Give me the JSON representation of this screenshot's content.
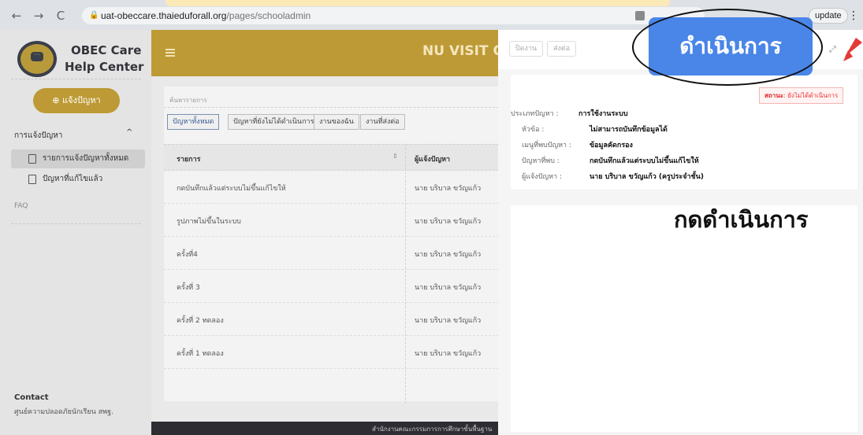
{
  "browser": {
    "url_host": "uat-obeccare.thaieduforall.org",
    "url_path": "/pages/schooladmin",
    "update_label": "update"
  },
  "sidebar": {
    "brand_line1": "OBEC Care",
    "brand_line2": "Help Center",
    "report_button": "แจ้งปัญหา",
    "section_title": "การแจ้งปัญหา",
    "items": [
      {
        "label": "รายการแจ้งปัญหาทั้งหมด",
        "active": true
      },
      {
        "label": "ปัญหาที่แก้ไขแล้ว",
        "active": false
      }
    ],
    "faq": "FAQ",
    "contact_title": "Contact",
    "contact_sub": "ศูนย์ความปลอดภัยนักเรียน สพฐ."
  },
  "header": {
    "title": "NU VISIT OT"
  },
  "list": {
    "search_placeholder": "ค้นหารายการ",
    "tabs": [
      "ปัญหาทั้งหมด",
      "ปัญหาที่ยังไม่ได้ดำเนินการ",
      "งานของฉัน",
      "งานที่ส่งต่อ"
    ],
    "columns": [
      "รายการ",
      "ผู้แจ้งปัญหา"
    ],
    "rows": [
      {
        "item": "กดบันทึกแล้วแต่ระบบไม่ขึ้นแก้ไขให้",
        "reporter": "นาย บริบาล ขวัญแก้ว"
      },
      {
        "item": "รูปภาพไม่ขึ้นในระบบ",
        "reporter": "นาย บริบาล ขวัญแก้ว"
      },
      {
        "item": "ครั้งที่4",
        "reporter": "นาย บริบาล ขวัญแก้ว"
      },
      {
        "item": "ครั้งที่ 3",
        "reporter": "นาย บริบาล ขวัญแก้ว"
      },
      {
        "item": "ครั้งที่ 2 ทดลอง",
        "reporter": "นาย บริบาล ขวัญแก้ว"
      },
      {
        "item": "ครั้งที่ 1 ทดลอง",
        "reporter": "นาย บริบาล ขวัญแก้ว"
      }
    ]
  },
  "footer": {
    "text": "สำนักงานคณะกรรมการการศึกษาขั้นพื้นฐาน"
  },
  "drawer": {
    "close_label": "ปิดงาน",
    "forward_label": "ส่งต่อ",
    "status_key": "สถานะ",
    "status_value": ": ยังไม่ได้ดำเนินการ",
    "fields": [
      {
        "key": "ประเภทปัญหา :",
        "value": "การใช้งานระบบ"
      },
      {
        "key": "หัวข้อ :",
        "value": "ไม่สามารถบันทึกข้อมูลได้"
      },
      {
        "key": "เมนูที่พบปัญหา :",
        "value": "ข้อมูลคัดกรอง"
      },
      {
        "key": "ปัญหาที่พบ :",
        "value": "กดบันทึกแล้วแต่ระบบไม่ขึ้นแก้ไขให้"
      },
      {
        "key": "ผู้แจ้งปัญหา :",
        "value": "นาย บริบาล ขวัญแก้ว (ครูประจำชั้น)"
      }
    ]
  },
  "annotation": {
    "action_button": "ดำเนินการ",
    "instruction": "กดดำเนินการ"
  },
  "colors": {
    "accent_gold": "#bd9a35",
    "callout_blue": "#4a86e8",
    "status_red": "#e02020"
  }
}
